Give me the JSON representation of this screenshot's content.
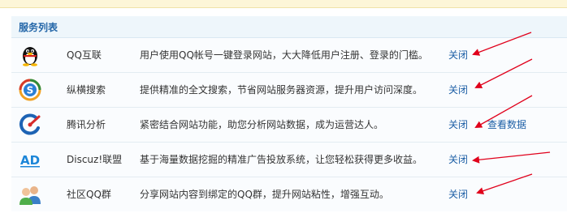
{
  "panel": {
    "title": "服务列表"
  },
  "services": [
    {
      "name": "QQ互联",
      "desc": "用户使用QQ帐号一键登录网站，大大降低用户注册、登录的门槛。",
      "action": "关闭",
      "icon": "qq-penguin-icon"
    },
    {
      "name": "纵横搜索",
      "desc": "提供精准的全文搜索，节省网站服务器资源，提升用户访问深度。",
      "action": "关闭",
      "icon": "soso-search-icon"
    },
    {
      "name": "腾讯分析",
      "desc": "紧密结合网站功能，助您分析网站数据，成为运营达人。",
      "action": "关闭",
      "extra_action": "查看数据",
      "icon": "tencent-analytics-icon"
    },
    {
      "name": "Discuz!联盟",
      "desc": "基于海量数据挖掘的精准广告投放系统，让您轻松获得更多收益。",
      "action": "关闭",
      "icon": "ad-union-icon"
    },
    {
      "name": "社区QQ群",
      "desc": "分享网站内容到绑定的QQ群，提升网站粘性，增强互动。",
      "action": "关闭",
      "icon": "qq-group-icon"
    }
  ],
  "annotations": {
    "arrow_color": "#e0001b"
  }
}
